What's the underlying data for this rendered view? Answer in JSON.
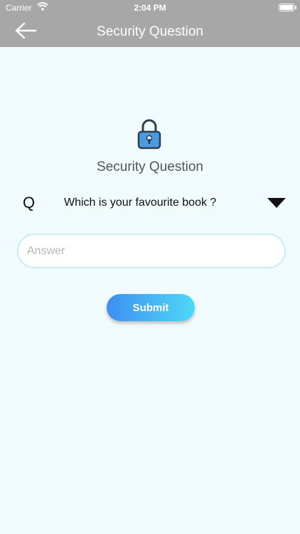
{
  "status_bar": {
    "carrier": "Carrier",
    "time": "2:04 PM"
  },
  "nav": {
    "title": "Security Question",
    "back_icon": "arrow-left-icon"
  },
  "content": {
    "lock_icon": "padlock-icon",
    "heading": "Security Question",
    "question_prefix": "Q",
    "question": "Which is your favourite book ?",
    "dropdown_icon": "triangle-down-icon",
    "answer_placeholder": "Answer",
    "answer_value": "",
    "submit_label": "Submit"
  },
  "colors": {
    "header_bg": "#a7a7a7",
    "page_bg": "#f1fbfd",
    "button_start": "#3d8ff2",
    "button_end": "#4fd8f7",
    "lock_fill": "#4a9be0"
  }
}
